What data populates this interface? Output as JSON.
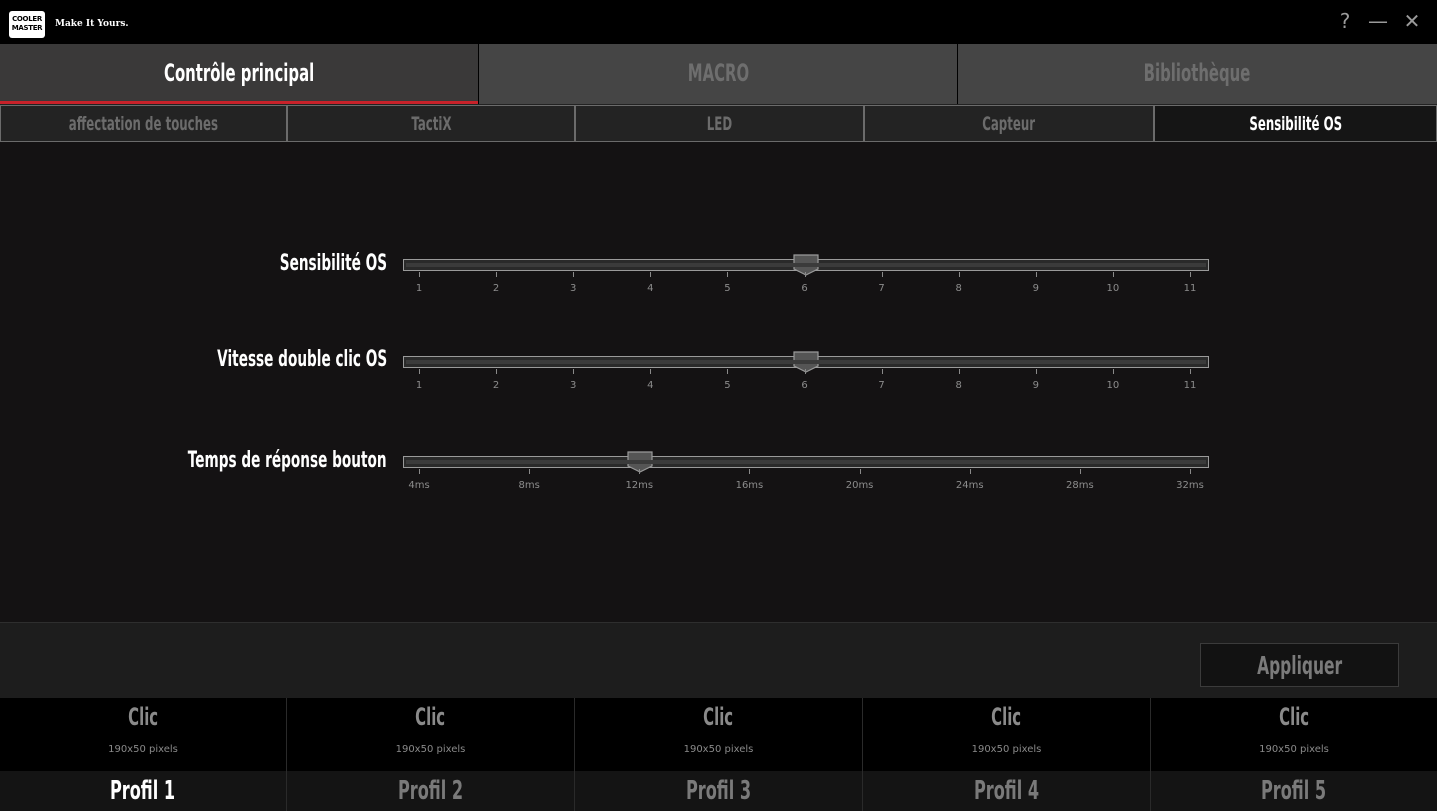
{
  "app": {
    "logo_text": "COOLER MASTER",
    "tagline": "Make It Yours.",
    "help_label": "?",
    "minimize_label": "—",
    "close_label": "✕"
  },
  "main_tabs": [
    {
      "label": "Contrôle principal",
      "active": true
    },
    {
      "label": "MACRO",
      "active": false
    },
    {
      "label": "Bibliothèque",
      "active": false
    }
  ],
  "sub_tabs": [
    {
      "label": "affectation de touches",
      "active": false
    },
    {
      "label": "TactiX",
      "active": false
    },
    {
      "label": "LED",
      "active": false
    },
    {
      "label": "Capteur",
      "active": false
    },
    {
      "label": "Sensibilité OS",
      "active": true
    }
  ],
  "sliders": [
    {
      "label": "Sensibilité OS",
      "ticks": [
        "1",
        "2",
        "3",
        "4",
        "5",
        "6",
        "7",
        "8",
        "9",
        "10",
        "11"
      ],
      "value_index": 5
    },
    {
      "label": "Vitesse double clic OS",
      "ticks": [
        "1",
        "2",
        "3",
        "4",
        "5",
        "6",
        "7",
        "8",
        "9",
        "10",
        "11"
      ],
      "value_index": 5
    },
    {
      "label": "Temps de réponse bouton",
      "ticks": [
        "4ms",
        "8ms",
        "12ms",
        "16ms",
        "20ms",
        "24ms",
        "28ms",
        "32ms"
      ],
      "value_index": 2
    }
  ],
  "apply_label": "Appliquer",
  "profiles": [
    {
      "action": "Clic",
      "size": "190x50 pixels",
      "name": "Profil 1",
      "active": true
    },
    {
      "action": "Clic",
      "size": "190x50 pixels",
      "name": "Profil 2",
      "active": false
    },
    {
      "action": "Clic",
      "size": "190x50 pixels",
      "name": "Profil 3",
      "active": false
    },
    {
      "action": "Clic",
      "size": "190x50 pixels",
      "name": "Profil 4",
      "active": false
    },
    {
      "action": "Clic",
      "size": "190x50 pixels",
      "name": "Profil 5",
      "active": false
    }
  ],
  "colors": {
    "accent": "#c7222a",
    "background": "#141213"
  }
}
